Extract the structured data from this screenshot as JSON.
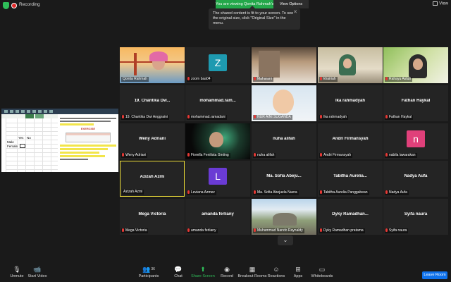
{
  "topbar": {
    "recording": "Recording",
    "viewing": "You are viewing Qonita Rahmah's screen",
    "view_options": "View Options",
    "view": "View"
  },
  "tooltip": {
    "text": "The shared content is fit to your screen. To see the original size, click \"Original Size\" in the menu.",
    "close": "✕"
  },
  "shared_screen": {
    "cells": [
      "Yes",
      "No",
      "Male",
      "Female"
    ],
    "doc_title": "EXERCISE"
  },
  "participants": [
    {
      "name": "",
      "label": "Qonita Rahmah",
      "muted": false,
      "photo": "bridge"
    },
    {
      "name": "",
      "label": "zoom baa04",
      "muted": true,
      "avatar": "Z",
      "color": "#1e9ab0"
    },
    {
      "name": "",
      "label": "Maharani",
      "muted": true,
      "photo": "room"
    },
    {
      "name": "",
      "label": "khairiah",
      "muted": true,
      "photo": "warm"
    },
    {
      "name": "",
      "label": "Rahayu Astuti",
      "muted": true,
      "photo": "green"
    },
    {
      "name": "19. Chantika Dw...",
      "label": "19. Chantika Dwi Anggraini",
      "muted": true
    },
    {
      "name": "mohammad.ram...",
      "label": "mohammad.ramadani",
      "muted": true
    },
    {
      "name": "",
      "label": "NUR AINI SUGANDA",
      "muted": true,
      "photo": "baby"
    },
    {
      "name": "Ika rahmadyah",
      "label": "Ika rahmadyah",
      "muted": true
    },
    {
      "name": "Fathan Haykal",
      "label": "Fathan Haykal",
      "muted": true
    },
    {
      "name": "Weny Adriani",
      "label": "Weny Adriani",
      "muted": true
    },
    {
      "name": "",
      "label": "Fiorella Fenilista Ginting",
      "muted": true,
      "photo": "dark"
    },
    {
      "name": "nuha alifah",
      "label": "nuha alifah",
      "muted": true
    },
    {
      "name": "Andri Firmansyah",
      "label": "Andri Firmansyah",
      "muted": true
    },
    {
      "name": "",
      "label": "nabila lawarakan",
      "muted": true,
      "avatar": "n",
      "color": "#e0407a"
    },
    {
      "name": "Azizah Azmi",
      "label": "Azizah Azmi",
      "muted": false,
      "active": true
    },
    {
      "name": "",
      "label": "Leviana Azmez",
      "muted": true,
      "avatar": "L",
      "color": "#6a3bd4"
    },
    {
      "name": "Ma. Sofia Abeju...",
      "label": "Ma. Sofia Abejuela Nuera",
      "muted": true
    },
    {
      "name": "Tabitha Aurelia...",
      "label": "Tabitha Aurelia Panggabean",
      "muted": true
    },
    {
      "name": "Nadya Aufa",
      "label": "Nadya Aufa",
      "muted": true
    },
    {
      "name": "Mega Victoria",
      "label": "Mega Victoria",
      "muted": true
    },
    {
      "name": "amanda ferliany",
      "label": "amanda ferliany",
      "muted": true
    },
    {
      "name": "",
      "label": "Muhammad Nando Raynaldy",
      "muted": true,
      "photo": "stone"
    },
    {
      "name": "Dyky Ramadhan...",
      "label": "Dyky Ramadhan pratama",
      "muted": true
    },
    {
      "name": "Syifa naura",
      "label": "Syifa naura",
      "muted": true
    }
  ],
  "toolbar": {
    "unmute": "Unmute",
    "start_video": "Start Video",
    "participants": "Participants",
    "participants_count": "36",
    "chat": "Chat",
    "share_screen": "Share Screen",
    "record": "Record",
    "breakout_rooms": "Breakout Rooms",
    "reactions": "Reactions",
    "apps": "Apps",
    "whiteboards": "Whiteboards",
    "leave": "Leave Room"
  },
  "colors": {
    "share_green": "#2fbd59",
    "active_speaker": "#f2e23a",
    "leave_blue": "#0e71eb",
    "muted_red": "#e53935"
  }
}
